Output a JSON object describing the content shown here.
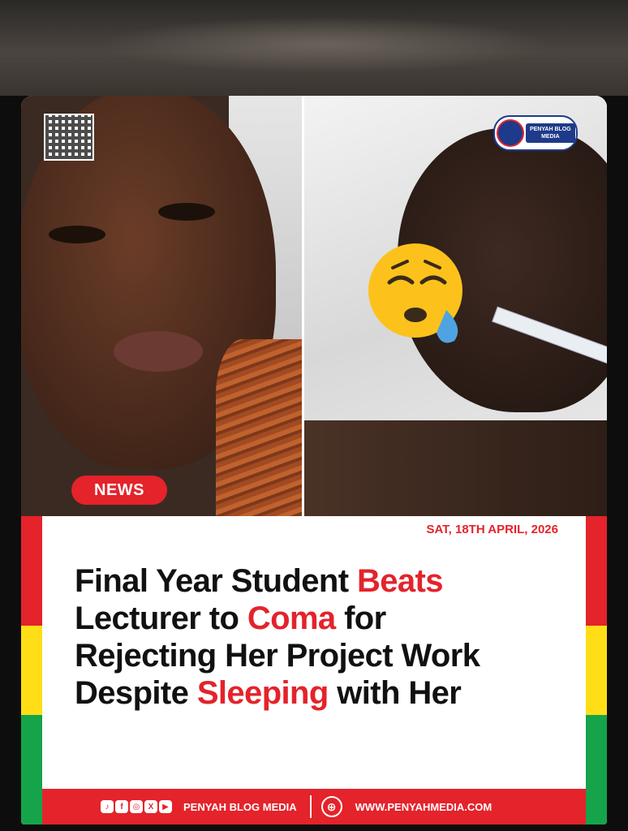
{
  "badge": "NEWS",
  "date": "SAT, 18TH APRIL, 2026",
  "headline": {
    "l1a": "Final Year Student ",
    "l1b": "Beats",
    "l2a": "Lecturer to ",
    "l2b": "Coma",
    "l2c": " for",
    "l3": "Rejecting Her Project Work",
    "l4a": "Despite ",
    "l4b": "Sleeping",
    "l4c": " with Her"
  },
  "logo": {
    "line1": "PENYAH BLOG",
    "line2": "MEDIA"
  },
  "footer": {
    "brand": "PENYAH BLOG MEDIA",
    "url": "WWW.PENYAHMEDIA.COM",
    "socials": [
      "tiktok-icon",
      "facebook-icon",
      "instagram-icon",
      "x-icon",
      "youtube-icon"
    ]
  },
  "colors": {
    "accent": "#e4232b",
    "flag_yellow": "#ffde17",
    "flag_green": "#15a44a",
    "brand_blue": "#1e3a8a"
  }
}
